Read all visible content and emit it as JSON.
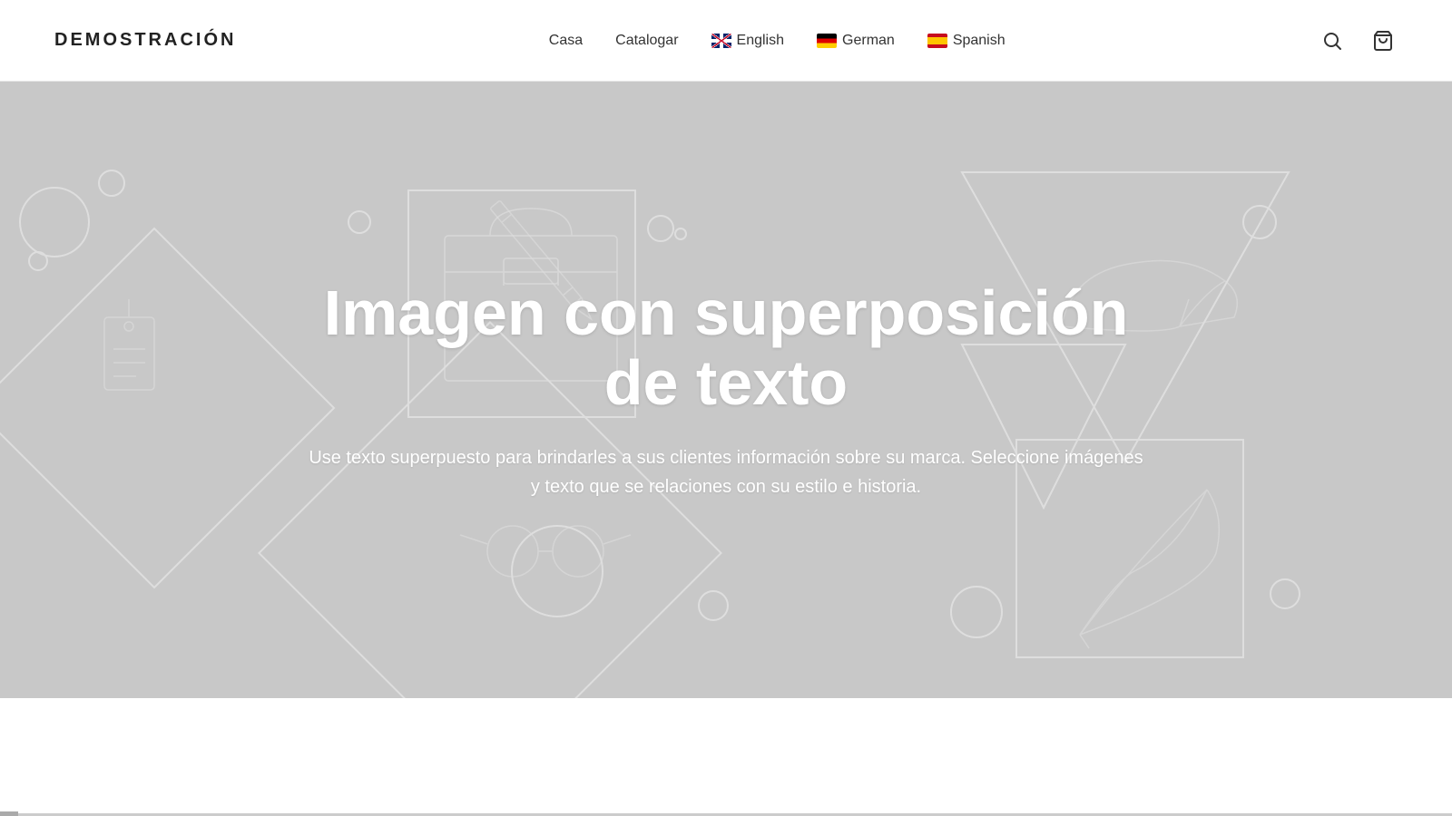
{
  "header": {
    "brand": "DEMOSTRACIÓN",
    "nav": {
      "casa_label": "Casa",
      "catalogar_label": "Catalogar"
    },
    "languages": [
      {
        "id": "english",
        "flag": "uk",
        "label": "English"
      },
      {
        "id": "german",
        "flag": "de",
        "label": "German"
      },
      {
        "id": "spanish",
        "flag": "es",
        "label": "Spanish"
      }
    ]
  },
  "hero": {
    "title": "Imagen con superposición de texto",
    "subtitle": "Use texto superpuesto para brindarles a sus clientes información sobre su marca. Seleccione imágenes y texto que se relaciones con su estilo e historia.",
    "bg_color": "#c4c4c4"
  }
}
